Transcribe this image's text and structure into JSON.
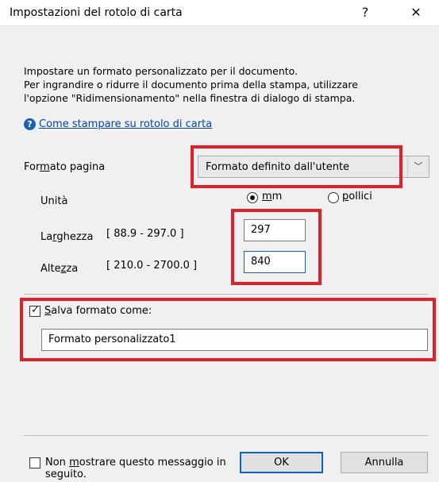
{
  "window": {
    "title": "Impostazioni del rotolo di carta",
    "help_glyph": "?",
    "close_glyph": "✕"
  },
  "intro": {
    "line1": "Impostare un formato personalizzato per il documento.",
    "line2": "Per ingrandire o ridurre il documento prima della stampa, utilizzare",
    "line3": "l'opzione \"Ridimensionamento\" nella finestra di dialogo di stampa."
  },
  "help_link": {
    "icon": "?",
    "icon_name": "help-circle-icon",
    "label": "Come stampare su rotolo di carta"
  },
  "page_format": {
    "label_pre": "For",
    "label_accel": "m",
    "label_post": "ato pagina",
    "value": "Formato definito dall'utente",
    "arrow": "﹀"
  },
  "units": {
    "label": "Unità",
    "mm_pre": "",
    "mm_accel": "m",
    "mm_post": "m",
    "mm_selected": true,
    "inch_pre": "",
    "inch_accel": "p",
    "inch_post": "ollici"
  },
  "width": {
    "label_pre": "La",
    "label_accel": "r",
    "label_post": "ghezza",
    "range": "[ 88.9 - 297.0 ]",
    "value": "297"
  },
  "height": {
    "label_pre": "Alte",
    "label_accel": "z",
    "label_post": "za",
    "range": "[ 210.0 - 2700.0 ]",
    "value": "840"
  },
  "save_format": {
    "checked": true,
    "label_pre": "",
    "label_accel": "S",
    "label_post": "alva formato come:",
    "value": "Formato personalizzato1"
  },
  "footer": {
    "dont_show_line1_pre": "Non ",
    "dont_show_line1_accel": "m",
    "dont_show_line1_post": "ostrare questo messaggio in",
    "dont_show_line2": "seguito.",
    "dont_show_checked": false,
    "ok_label": "OK",
    "cancel_label": "Annulla"
  },
  "colors": {
    "highlight": "#e0202a",
    "link": "#0645ad",
    "focus": "#0a64c8",
    "background": "#f0f0f0"
  }
}
